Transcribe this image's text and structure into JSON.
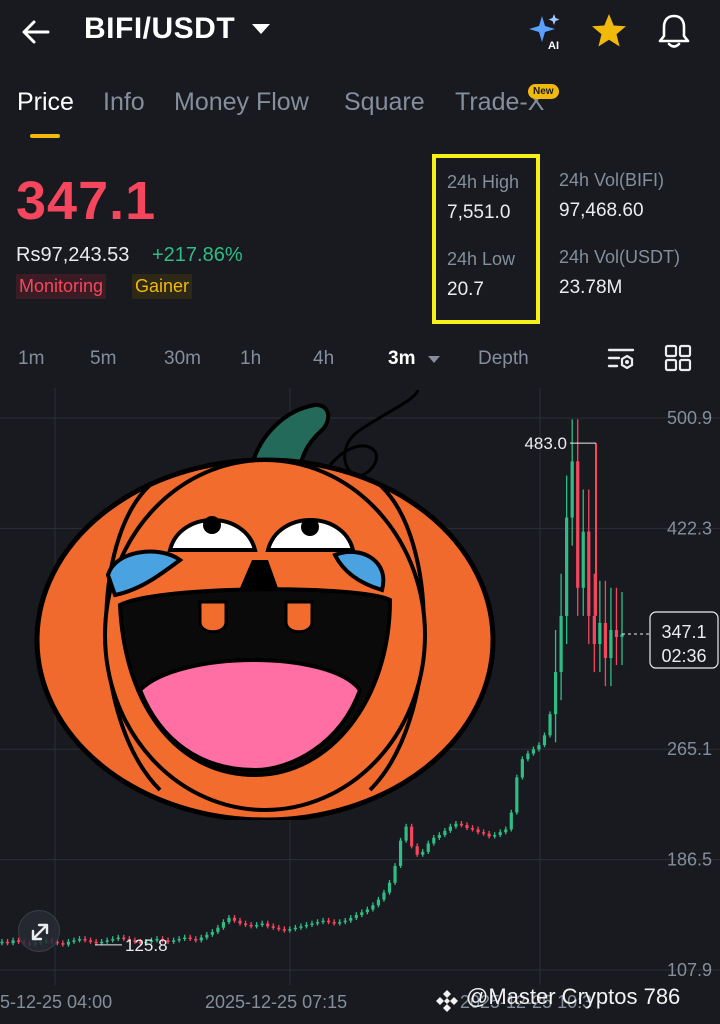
{
  "header": {
    "pair": "BIFI/USDT",
    "icons": [
      "back-arrow-icon",
      "ai-sparkle-icon",
      "star-icon",
      "bell-icon"
    ],
    "star_color": "#f0b90b"
  },
  "tabs": [
    {
      "label": "Price",
      "active": true
    },
    {
      "label": "Info"
    },
    {
      "label": "Money Flow"
    },
    {
      "label": "Square"
    },
    {
      "label": "Trade-X",
      "badge": "New"
    }
  ],
  "ticker": {
    "last_price": "347.1",
    "fiat_price": "Rs97,243.53",
    "change": "+217.86%",
    "tags": [
      "Monitoring",
      "Gainer"
    ],
    "high_label": "24h High",
    "high_value": "7,551.0",
    "low_label": "24h Low",
    "low_value": "20.7",
    "vol_base_label": "24h Vol(BIFI)",
    "vol_base_value": "97,468.60",
    "vol_quote_label": "24h Vol(USDT)",
    "vol_quote_value": "23.78M",
    "up_color": "#2ebd85",
    "down_color": "#f6465d"
  },
  "intervals": {
    "items": [
      "1m",
      "5m",
      "30m",
      "1h",
      "4h",
      "3m",
      "Depth"
    ],
    "selected": "3m"
  },
  "chart": {
    "price_axis": [
      "500.9",
      "422.3",
      "265.1",
      "186.5",
      "107.9"
    ],
    "time_axis": [
      "5-12-25 04:00",
      "2025-12-25 07:15",
      "2025-12-25 10:3"
    ],
    "high_marker": "483.0",
    "low_marker": "125.8",
    "last_price_tag": "347.1",
    "countdown": "02:36"
  },
  "chart_data": {
    "type": "candlestick",
    "ylim": [
      107.9,
      500.9
    ],
    "yticks": [
      500.9,
      422.3,
      265.1,
      186.5,
      107.9
    ],
    "annotations": {
      "high": 483.0,
      "low": 125.8,
      "last": 347.1
    },
    "close_series_approx": [
      128,
      127,
      129,
      128,
      127,
      126,
      127,
      128,
      129,
      128,
      127,
      126,
      128,
      129,
      130,
      129,
      128,
      127,
      128,
      129,
      130,
      131,
      130,
      129,
      128,
      127,
      128,
      129,
      130,
      129,
      128,
      129,
      130,
      131,
      130,
      129,
      131,
      133,
      135,
      138,
      142,
      145,
      143,
      141,
      140,
      139,
      140,
      141,
      139,
      138,
      137,
      136,
      137,
      138,
      139,
      140,
      141,
      142,
      143,
      142,
      141,
      142,
      143,
      145,
      147,
      149,
      151,
      154,
      158,
      163,
      170,
      182,
      200,
      210,
      196,
      190,
      192,
      198,
      202,
      204,
      207,
      210,
      212,
      211,
      209,
      208,
      206,
      205,
      203,
      204,
      206,
      208,
      220,
      245,
      258,
      262,
      265,
      268,
      275,
      290,
      320,
      360,
      430,
      470,
      380,
      420,
      360,
      340,
      355,
      330,
      350,
      345,
      347
    ]
  },
  "watermark": "@Master Cryptos 786"
}
